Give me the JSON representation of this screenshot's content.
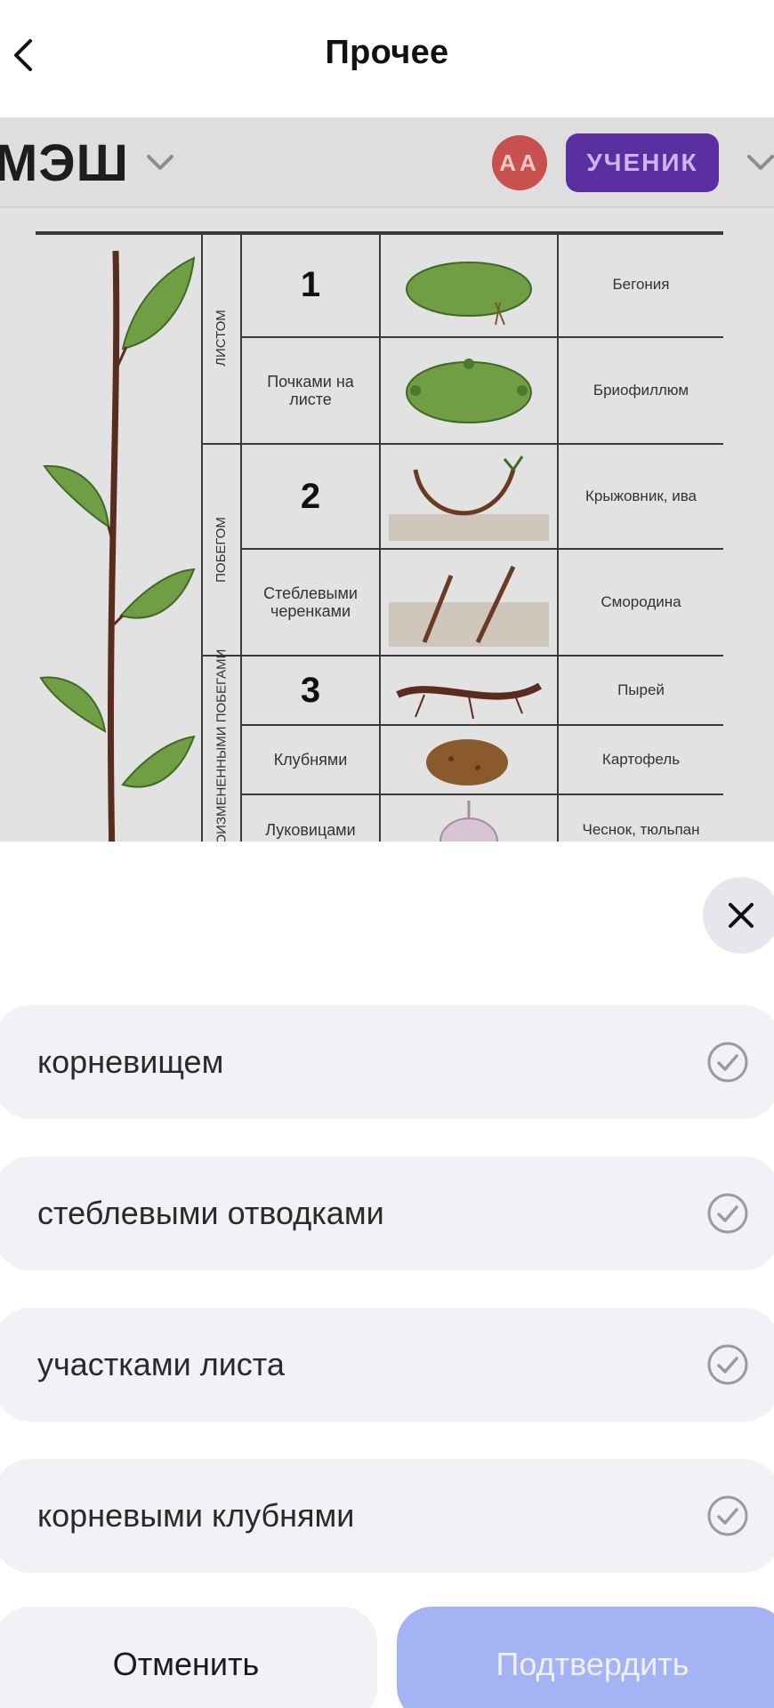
{
  "navbar": {
    "title": "Прочее",
    "back_icon": "chevron-left-icon"
  },
  "app_header": {
    "brand": "МЭШ",
    "avatar_initials": "АА",
    "role_badge": "УЧЕНИК",
    "colors": {
      "avatar": "#c8504f",
      "role_badge": "#5a2fa0"
    }
  },
  "table": {
    "groups": [
      {
        "label": "листом",
        "rows": [
          {
            "method": "1",
            "plant": "Бегония",
            "picture": "begonia-leaf-icon"
          },
          {
            "method": "Почками на листе",
            "plant": "Бриофиллюм",
            "picture": "bryophyllum-leaf-icon"
          }
        ]
      },
      {
        "label": "побегом",
        "rows": [
          {
            "method": "2",
            "plant": "Крыжовник, ива",
            "picture": "layering-shoot-icon"
          },
          {
            "method": "Стеблевыми черенками",
            "plant": "Смородина",
            "picture": "cuttings-icon"
          }
        ]
      },
      {
        "label": "видоизмененными побегами",
        "rows": [
          {
            "method": "3",
            "plant": "Пырей",
            "picture": "rhizome-icon"
          },
          {
            "method": "Клубнями",
            "plant": "Картофель",
            "picture": "potato-tuber-icon"
          },
          {
            "method": "Луковицами",
            "plant": "Чеснок, тюльпан",
            "picture": "garlic-bulb-icon"
          }
        ]
      }
    ]
  },
  "sheet": {
    "close_icon": "close-icon",
    "options": [
      {
        "label": "корневищем",
        "icon": "check-circle-icon"
      },
      {
        "label": "стеблевыми отводками",
        "icon": "check-circle-icon"
      },
      {
        "label": "участками листа",
        "icon": "check-circle-icon"
      },
      {
        "label": "корневыми клубнями",
        "icon": "check-circle-icon"
      }
    ],
    "cancel_label": "Отменить",
    "confirm_label": "Подтвердить",
    "colors": {
      "confirm_button": "#a3b3f4",
      "option_bg": "#f1f1f6"
    }
  }
}
